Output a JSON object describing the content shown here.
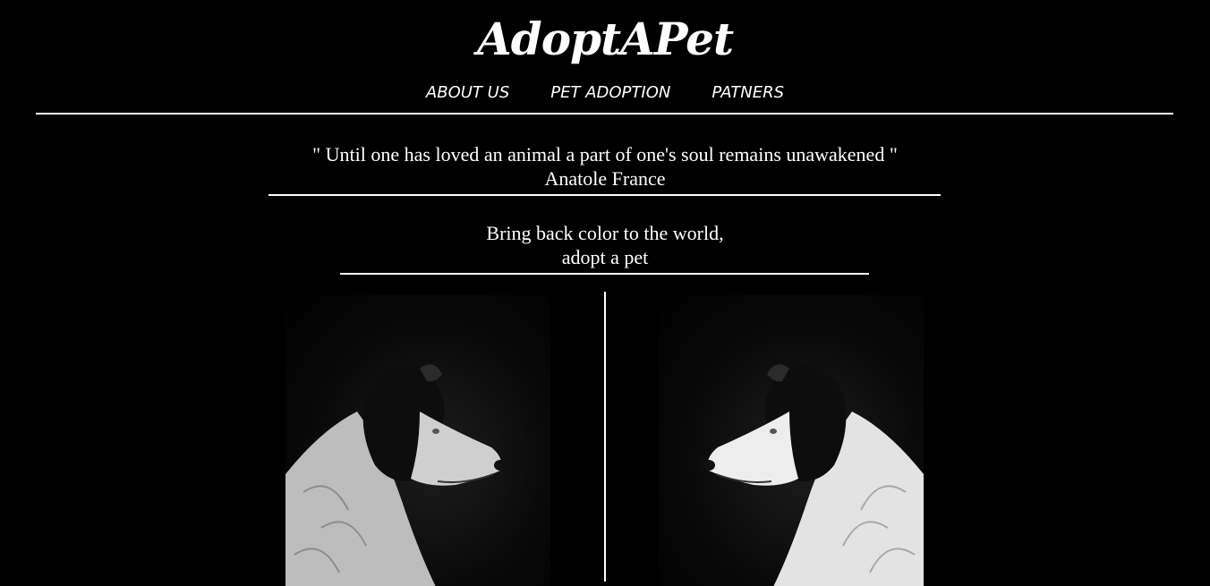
{
  "header": {
    "site_title": "AdoptAPet",
    "nav": [
      {
        "label": "ABOUT US"
      },
      {
        "label": "PET ADOPTION"
      },
      {
        "label": "PATNERS"
      }
    ]
  },
  "quote": {
    "text": "\" Until one has loved an animal a part of one's soul remains unawakened \"",
    "author": "Anatole France"
  },
  "tagline": {
    "line1": "Bring back color to the world,",
    "line2": "adopt a pet"
  },
  "gallery": {
    "images": [
      {
        "icon": "dog-profile-facing-right"
      },
      {
        "icon": "dog-profile-facing-left"
      }
    ]
  },
  "colors": {
    "background": "#000000",
    "text": "#ffffff"
  }
}
